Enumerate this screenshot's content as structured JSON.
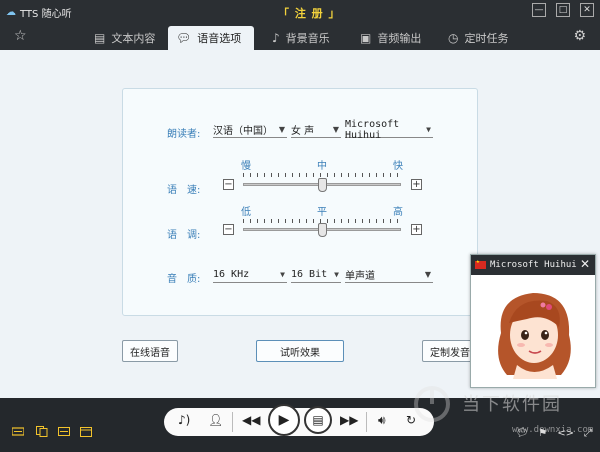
{
  "window": {
    "app_title": "TTS 随心听",
    "register_label": "「 注 册 」",
    "minimize": "—",
    "maximize": "□",
    "close": "✕"
  },
  "tabs": [
    {
      "label": "文本内容",
      "icon": "document-icon",
      "active": false
    },
    {
      "label": "语音选项",
      "icon": "speech-bubble-icon",
      "active": true
    },
    {
      "label": "背景音乐",
      "icon": "music-note-icon",
      "active": false
    },
    {
      "label": "音频输出",
      "icon": "film-icon",
      "active": false
    },
    {
      "label": "定时任务",
      "icon": "clock-icon",
      "active": false
    }
  ],
  "voice_options": {
    "reader_label": "朗读者:",
    "language": "汉语（中国）",
    "gender": "女 声",
    "voice": "Microsoft Huihui",
    "speed_label": "语　速:",
    "speed_scale": [
      "慢",
      "中",
      "快"
    ],
    "speed_value": 0.5,
    "pitch_label": "语　调:",
    "pitch_scale": [
      "低",
      "平",
      "高"
    ],
    "pitch_value": 0.5,
    "quality_label": "音　质:",
    "sample_rate": "16 KHz",
    "bit_depth": "16 Bit",
    "channels": "单声道",
    "minus": "−",
    "plus": "+"
  },
  "buttons": {
    "online_voice": "在线语音",
    "preview": "试听效果",
    "custom_voice": "定制发音"
  },
  "voice_card": {
    "title": "Microsoft Huihui"
  },
  "watermark": {
    "text": "当下软件园",
    "url": "www.downxia.com"
  }
}
